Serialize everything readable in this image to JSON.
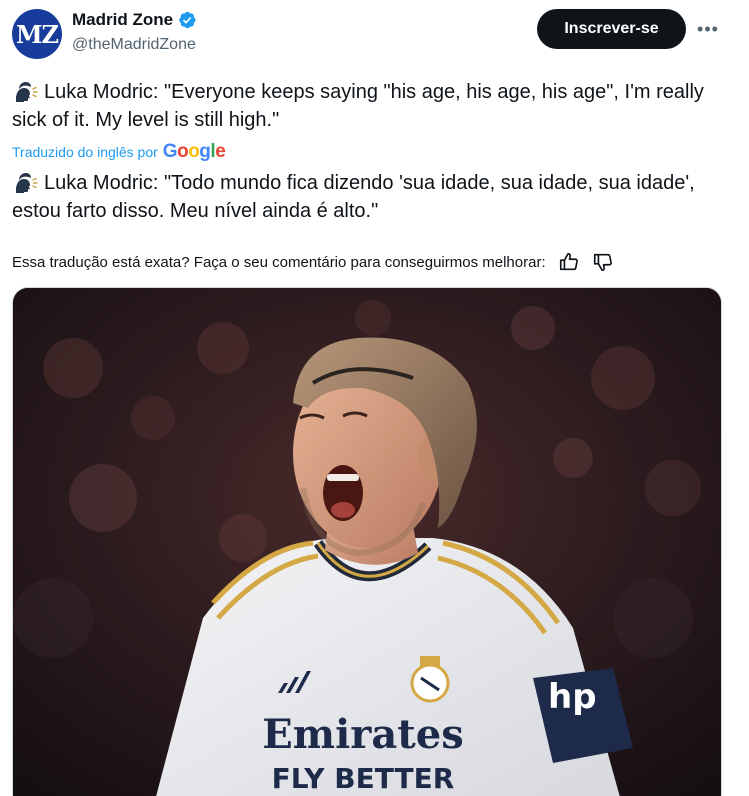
{
  "header": {
    "author_name": "Madrid Zone",
    "author_handle": "@theMadridZone",
    "avatar_text": "MZ",
    "subscribe_label": "Inscrever-se",
    "more_label": "•••"
  },
  "tweet": {
    "original_text": "Luka Modric: \"Everyone keeps saying \"his age, his age, his age\", I'm really sick of it. My level is still high.\"",
    "translated_by": "Traduzido do inglês por",
    "google_brand": "Google",
    "translated_text": "Luka Modric: \"Todo mundo fica dizendo 'sua idade, sua idade, sua idade', estou farto disso. Meu nível ainda é alto.\"",
    "feedback_prompt": "Essa tradução está exata? Faça o seu comentário para conseguirmos melhorar:"
  },
  "media": {
    "jersey_sponsor_line1": "Emirates",
    "jersey_sponsor_line2": "FLY BETTER",
    "sleeve_text": "hp"
  },
  "colors": {
    "brand_blue": "#1d9bf0",
    "text_primary": "#0f1419",
    "text_secondary": "#536471",
    "button_dark": "#0f1419",
    "avatar_bg": "#173c9c"
  },
  "icons": {
    "verified": "verified-badge-icon",
    "speaking_head": "speaking-head-icon",
    "thumbs_up": "thumbs-up-icon",
    "thumbs_down": "thumbs-down-icon",
    "more": "more-horizontal-icon"
  }
}
